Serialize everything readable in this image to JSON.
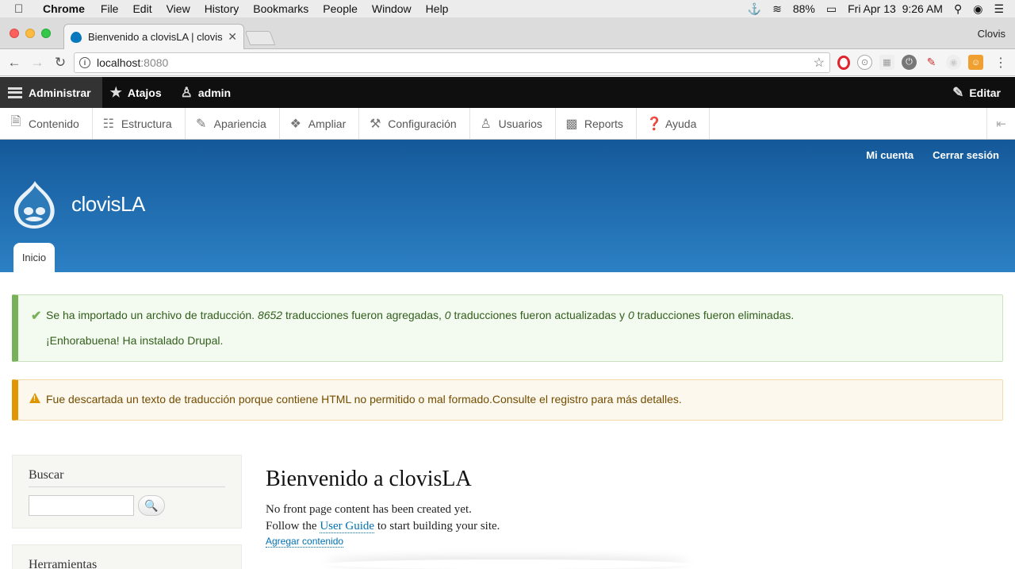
{
  "mac_menu": {
    "app_name": "Chrome",
    "items": [
      "File",
      "Edit",
      "View",
      "History",
      "Bookmarks",
      "People",
      "Window",
      "Help"
    ],
    "battery": "88%",
    "datetime": "Fri Apr 13  9:26 AM"
  },
  "browser": {
    "tab_title": "Bienvenido a clovisLA | clovisL",
    "profile_name": "Clovis",
    "url_host": "localhost",
    "url_port": ":8080"
  },
  "admin_toolbar": {
    "manage": "Administrar",
    "shortcuts": "Atajos",
    "user": "admin",
    "edit": "Editar"
  },
  "admin_tray": {
    "items": [
      {
        "label": "Contenido",
        "icon": "file-icon"
      },
      {
        "label": "Estructura",
        "icon": "structure-icon"
      },
      {
        "label": "Apariencia",
        "icon": "paint-icon"
      },
      {
        "label": "Ampliar",
        "icon": "puzzle-icon"
      },
      {
        "label": "Configuración",
        "icon": "wrench-icon"
      },
      {
        "label": "Usuarios",
        "icon": "users-icon"
      },
      {
        "label": "Reports",
        "icon": "bars-icon"
      },
      {
        "label": "Ayuda",
        "icon": "help-icon"
      }
    ]
  },
  "header": {
    "secondary_links": [
      "Mi cuenta",
      "Cerrar sesión"
    ],
    "site_name": "clovisLA",
    "primary_tab": "Inicio",
    "colors": {
      "top": "#14599a",
      "bottom": "#2c80c4"
    }
  },
  "messages": {
    "status": {
      "part1": "Se ha importado un archivo de traducción. ",
      "added_count": "8652",
      "part2": " traducciones fueron agregadas, ",
      "updated_count": "0",
      "part3": " traducciones fueron actualizadas y ",
      "deleted_count": "0",
      "part4": " traducciones fueron eliminadas.",
      "line2": "¡Enhorabuena! Ha instalado Drupal."
    },
    "warning": "Fue descartada un texto de traducción porque contiene HTML no permitido o mal formado.Consulte el registro para más detalles."
  },
  "sidebar": {
    "search_title": "Buscar",
    "search_value": "",
    "tools_title": "Herramientas"
  },
  "main": {
    "title": "Bienvenido a clovisLA",
    "line1": "No front page content has been created yet.",
    "line2_before": "Follow the ",
    "line2_link": "User Guide",
    "line2_after": " to start building your site.",
    "add_content": "Agregar contenido"
  }
}
